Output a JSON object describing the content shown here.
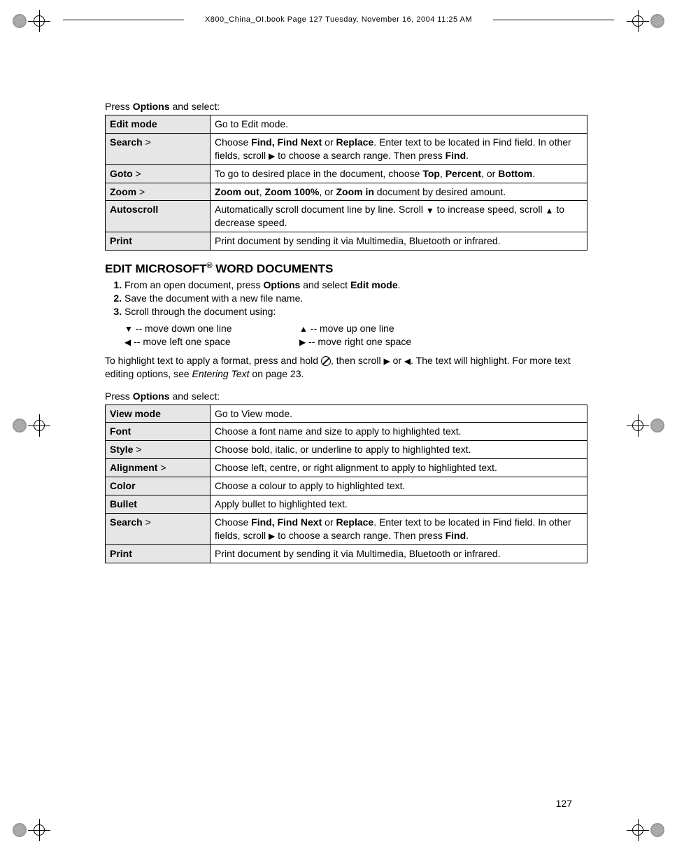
{
  "header": "X800_China_OI.book  Page 127  Tuesday, November 16, 2004  11:25 AM",
  "intro1": {
    "pre": "Press ",
    "bold": "Options",
    "post": " and select:"
  },
  "table1": [
    {
      "label": "Edit mode",
      "gt": false,
      "desc_html": "Go to Edit mode."
    },
    {
      "label": "Search",
      "gt": true,
      "desc_html": "Choose <b>Find, Find Next</b> or <b>Replace</b>. Enter text to be located in Find field. In other fields, scroll <span class=\"tri\">▶</span> to choose a search range. Then press <b>Find</b>."
    },
    {
      "label": "Goto",
      "gt": true,
      "desc_html": "To go to desired place in the document, choose <b>Top</b>, <b>Percent</b>, or <b>Bottom</b>."
    },
    {
      "label": "Zoom",
      "gt": true,
      "desc_html": "<b>Zoom out</b>, <b>Zoom 100%</b>, or <b>Zoom in</b> document by desired amount."
    },
    {
      "label": "Autoscroll",
      "gt": false,
      "desc_html": "Automatically scroll document line by line. Scroll <span class=\"tri\">▼</span> to increase speed, scroll <span class=\"tri\">▲</span> to decrease speed."
    },
    {
      "label": "Print",
      "gt": false,
      "desc_html": "Print document by sending it via Multimedia, Bluetooth or infrared."
    }
  ],
  "heading_html": "EDIT MICROSOFT<sup>®</sup> WORD DOCUMENTS",
  "steps": [
    "From an open document, press <b>Options</b> and select <b>Edit mode</b>.",
    "Save the document with a new file name.",
    "Scroll through the document using:"
  ],
  "arrows": [
    "<span class=\"tri\">▼</span> -- move down one line",
    "<span class=\"tri\">▲</span> -- move up one line",
    "<span class=\"tri\">◀</span> -- move left one space",
    "<span class=\"tri\">▶</span> -- move right one space"
  ],
  "highlight_html": "To highlight text to apply a format, press and hold <span class=\"circ-icon\"></span>, then scroll <span class=\"tri\">▶</span> or <span class=\"tri\">◀</span>. The text will highlight. For more text editing options, see <i>Entering Text</i> on page 23.",
  "intro2": {
    "pre": "Press ",
    "bold": "Options",
    "post": " and select:"
  },
  "table2": [
    {
      "label": "View mode",
      "gt": false,
      "desc_html": "Go to View mode."
    },
    {
      "label": "Font",
      "gt": false,
      "desc_html": "Choose a font name and size to apply to highlighted text."
    },
    {
      "label": "Style",
      "gt": true,
      "desc_html": "Choose bold, italic, or underline to apply to highlighted text."
    },
    {
      "label": "Alignment",
      "gt": true,
      "desc_html": "Choose left, centre, or right alignment to apply to highlighted text."
    },
    {
      "label": "Color",
      "gt": false,
      "desc_html": "Choose a colour to apply to highlighted text."
    },
    {
      "label": "Bullet",
      "gt": false,
      "desc_html": "Apply bullet to highlighted text."
    },
    {
      "label": "Search",
      "gt": true,
      "desc_html": "Choose <b>Find, Find Next</b> or <b>Replace</b>. Enter text to be located in Find field. In other fields, scroll <span class=\"tri\">▶</span> to choose a search range. Then press <b>Find</b>."
    },
    {
      "label": "Print",
      "gt": false,
      "desc_html": "Print document by sending it via Multimedia, Bluetooth or infrared."
    }
  ],
  "page_number": "127"
}
